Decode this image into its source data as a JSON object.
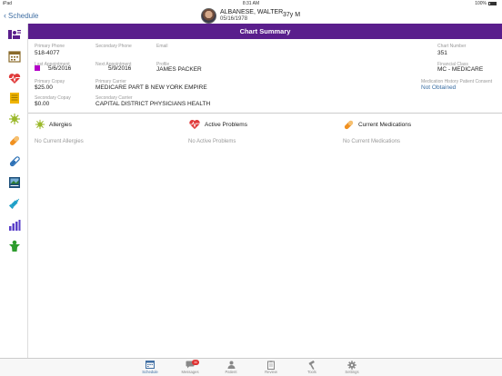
{
  "status": {
    "device": "iPad",
    "time": "8:31 AM",
    "battery": "100%"
  },
  "nav": {
    "back_label": "Schedule",
    "patient_name": "ALBANESE, WALTER",
    "patient_dob": "05/16/1978",
    "patient_age": "37y M"
  },
  "header": {
    "title": "Chart Summary"
  },
  "summary": {
    "primary_phone_label": "Primary Phone",
    "primary_phone": "518-4077",
    "secondary_phone_label": "Secondary Phone",
    "secondary_phone": "",
    "email_label": "Email",
    "email": "",
    "chart_number_label": "Chart Number",
    "chart_number": "351",
    "last_appt_label": "Last Appointment",
    "last_appt": "5/6/2016",
    "next_appt_label": "Next Appointment",
    "next_appt": "5/9/2016",
    "profile_label": "Profile",
    "profile": "JAMES PACKER",
    "financial_class_label": "Financial Class",
    "financial_class": "MC - MEDICARE",
    "primary_copay_label": "Primary Copay",
    "primary_copay": "$25.00",
    "primary_carrier_label": "Primary Carrier",
    "primary_carrier": "MEDICARE PART B NEW YORK EMPIRE",
    "med_consent_label": "Medication History Patient Consent",
    "med_consent": "Not Obtained",
    "secondary_copay_label": "Secondary Copay",
    "secondary_copay": "$0.00",
    "secondary_carrier_label": "Secondary Carrier",
    "secondary_carrier": "CAPITAL DISTRICT PHYSICIANS HEALTH"
  },
  "sections": {
    "allergies": {
      "title": "Allergies",
      "empty": "No Current Allergies"
    },
    "problems": {
      "title": "Active Problems",
      "empty": "No Active Problems"
    },
    "medications": {
      "title": "Current Medications",
      "empty": "No Current Medications"
    }
  },
  "tabs": [
    {
      "label": "Schedule"
    },
    {
      "label": "Messages",
      "badge": "11"
    },
    {
      "label": "Patient"
    },
    {
      "label": "Review"
    },
    {
      "label": "Tools"
    },
    {
      "label": "Settings"
    }
  ],
  "colors": {
    "accent": "#5a1e8c",
    "link": "#3f6ea3",
    "badge": "#e03030"
  }
}
